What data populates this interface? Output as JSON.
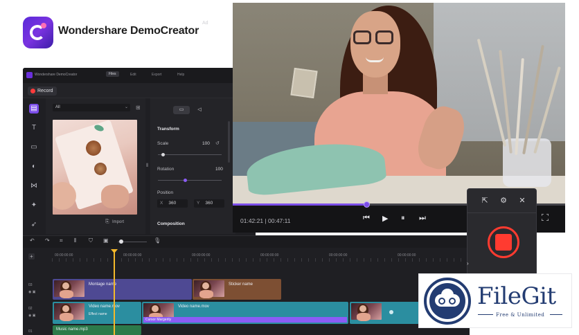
{
  "brand": {
    "name": "Wondershare DemoCreator"
  },
  "app": {
    "title": "Wondershare DemoCreator",
    "menu": [
      "Files",
      "Edit",
      "Export",
      "Help"
    ],
    "record_label": "Record",
    "add_label": "Ad",
    "filter": {
      "selected": "All"
    },
    "import_label": "Import",
    "properties": {
      "transform": "Transform",
      "scale_label": "Scale",
      "scale_value": "100",
      "rotation_label": "Rotation",
      "rotation_value": "100",
      "position_label": "Position",
      "x_label": "X",
      "x_value": "360",
      "y_label": "Y",
      "y_value": "360",
      "composition": "Composition"
    },
    "timeline": {
      "ruler_labels": [
        "00:00:00:00",
        "00:00:00:00",
        "00:00:00:00",
        "00:00:00:00",
        "00:00:00:00",
        "00:00:00:00"
      ],
      "track_numbers": [
        "03",
        "02",
        "01"
      ],
      "clips": {
        "montage": "Montage name",
        "sticker": "Sticker name",
        "video1": "Video name.mov",
        "effect": "Effect name",
        "video2": "Video name.mov",
        "cursor": "Cursor Margerity",
        "music": "Music name.mp3"
      }
    }
  },
  "player": {
    "time": "01:42:21 | 00:47:11",
    "progress": 0.4
  },
  "watermark": {
    "title": "FileGit",
    "subtitle": "Free & Unlimited"
  },
  "colors": {
    "accent": "#7b4de8",
    "record_red": "#ff3b30",
    "watermark_navy": "#233c72",
    "clip_purple": "#5a4d9e",
    "clip_teal": "#2b8ea0",
    "clip_brown": "#8a5a3a",
    "clip_green": "#2c7a4a",
    "playhead": "#f5b92a"
  }
}
